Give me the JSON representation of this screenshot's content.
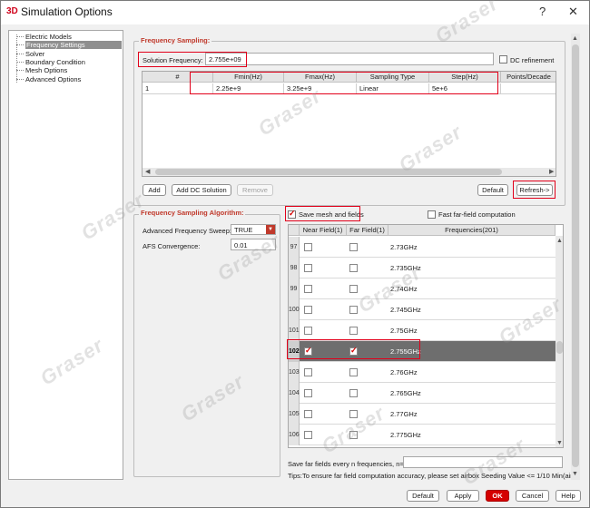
{
  "window": {
    "app_logo": "3D",
    "title": "Simulation Options",
    "help_btn": "?",
    "close_btn": "✕"
  },
  "tree": {
    "items": [
      {
        "label": "Electric Models"
      },
      {
        "label": "Frequency Settings",
        "selected": true
      },
      {
        "label": "Solver"
      },
      {
        "label": "Boundary Condition"
      },
      {
        "label": "Mesh Options"
      },
      {
        "label": "Advanced Options"
      }
    ]
  },
  "freq_sampling": {
    "title": "Frequency Sampling:",
    "solution_label": "Solution Frequency:",
    "solution_value": "2.755e+09",
    "dc_refinement": "DC refinement",
    "columns": [
      "#",
      "Fmin(Hz)",
      "Fmax(Hz)",
      "Sampling Type",
      "Step(Hz)",
      "Points/Decade"
    ],
    "rows": [
      [
        "1",
        "2.25e+9",
        "3.25e+9",
        "Linear",
        "5e+6",
        ""
      ]
    ],
    "add": "Add",
    "add_dc": "Add DC Solution",
    "remove": "Remove",
    "default": "Default",
    "refresh": "Refresh->"
  },
  "algorithm": {
    "title": "Frequency Sampling Algorithm:",
    "adv_label": "Advanced Frequency Sweep:",
    "adv_value": "TRUE",
    "afs_label": "AFS Convergence:",
    "afs_value": "0.01"
  },
  "fields": {
    "save_mesh": "Save mesh and fields",
    "fast_far": "Fast far-field computation",
    "columns": [
      "Near Field(1)",
      "Far Field(1)",
      "Frequencies(201)"
    ],
    "rows": [
      {
        "idx": "97",
        "freq": "2.73GHz",
        "near": false,
        "far": false
      },
      {
        "idx": "98",
        "freq": "2.735GHz",
        "near": false,
        "far": false
      },
      {
        "idx": "99",
        "freq": "2.74GHz",
        "near": false,
        "far": false
      },
      {
        "idx": "100",
        "freq": "2.745GHz",
        "near": false,
        "far": false
      },
      {
        "idx": "101",
        "freq": "2.75GHz",
        "near": false,
        "far": false
      },
      {
        "idx": "102",
        "freq": "2.755GHz",
        "near": true,
        "far": true,
        "selected": true
      },
      {
        "idx": "103",
        "freq": "2.76GHz",
        "near": false,
        "far": false
      },
      {
        "idx": "104",
        "freq": "2.765GHz",
        "near": false,
        "far": false
      },
      {
        "idx": "105",
        "freq": "2.77GHz",
        "near": false,
        "far": false
      },
      {
        "idx": "106",
        "freq": "2.775GHz",
        "near": false,
        "far": false
      }
    ],
    "every_n_label": "Save far fields every n frequencies, n=",
    "tips": "Tips:To ensure far field computation accuracy, please set airbox Seeding Value <= 1/10 Min(air"
  },
  "footer": {
    "default": "Default",
    "apply": "Apply",
    "ok": "OK",
    "cancel": "Cancel",
    "help": "Help"
  },
  "watermark": "Graser"
}
